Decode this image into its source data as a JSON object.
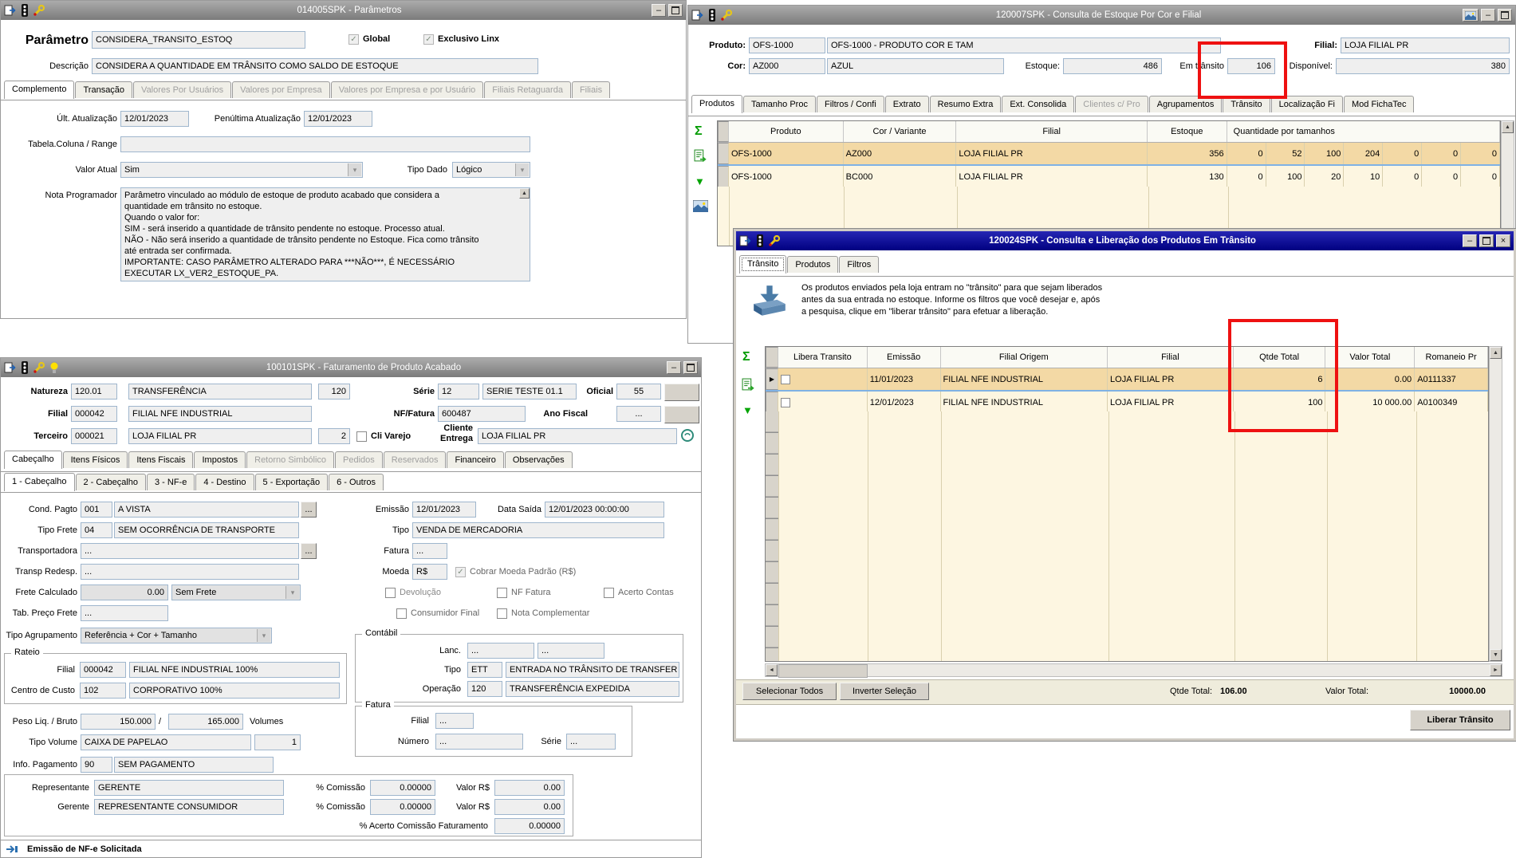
{
  "icons": {
    "sigma": "Σ",
    "filter_arrow": "▼",
    "row_marker": "▶",
    "arrow_up": "▲",
    "arrow_down": "▼",
    "arrow_left": "◄",
    "arrow_right": "►",
    "minimize": "–",
    "close": "×",
    "check": "✓",
    "combo": "▾",
    "dots": "..."
  },
  "win_parametros": {
    "title": "014005SPK - Parâmetros",
    "parametro_label": "Parâmetro",
    "parametro": "CONSIDERA_TRANSITO_ESTOQ",
    "global_label": "Global",
    "exclusivo_label": "Exclusivo Linx",
    "descricao_label": "Descrição",
    "descricao": "CONSIDERA A QUANTIDADE EM TRÂNSITO COMO SALDO DE ESTOQUE",
    "tabs": [
      "Complemento",
      "Transação",
      "Valores Por Usuários",
      "Valores por Empresa",
      "Valores por Empresa e por Usuário",
      "Filiais Retaguarda",
      "Filiais"
    ],
    "ult_label": "Últ. Atualização",
    "ult": "12/01/2023",
    "penultima_label": "Penúltima Atualização",
    "penultima": "12/01/2023",
    "tabela_label": "Tabela.Coluna / Range",
    "tabela_value": "",
    "valor_atual_label": "Valor Atual",
    "valor_atual": "Sim",
    "tipo_dado_label": "Tipo Dado",
    "tipo_dado": "Lógico",
    "nota_label": "Nota Programador",
    "nota": "Parâmetro vinculado ao módulo de estoque de produto acabado que considera a\nquantidade em trânsito no estoque.\nQuando o valor for:\nSIM - será inserido a quantidade de trânsito pendente no estoque. Processo atual.\nNÃO - Não será inserido a quantidade de trânsito pendente no Estoque. Fica como trânsito\naté entrada ser confirmada.\nIMPORTANTE: CASO PARÂMETRO ALTERADO PARA ***NÃO***, É NECESSÁRIO\nEXECUTAR LX_VER2_ESTOQUE_PA."
  },
  "win_estoque": {
    "title": "120007SPK - Consulta de Estoque Por Cor e Filial",
    "produto_label": "Produto:",
    "produto_cod": "OFS-1000",
    "produto_desc": "OFS-1000 - PRODUTO COR E TAM",
    "filial_label": "Filial:",
    "filial": "LOJA FILIAL PR",
    "cor_label": "Cor:",
    "cor_cod": "AZ000",
    "cor_desc": "AZUL",
    "estoque_label": "Estoque:",
    "estoque": "486",
    "em_transito_label": "Em trânsito",
    "em_transito": "106",
    "disponivel_label": "Disponível:",
    "disponivel": "380",
    "tabs": [
      "Produtos",
      "Tamanho Proc",
      "Filtros / Confi",
      "Extrato",
      "Resumo Extra",
      "Ext. Consolida",
      "Clientes c/ Pro",
      "Agrupamentos",
      "Trânsito",
      "Localização Fi",
      "Mod FichaTec"
    ],
    "grid": {
      "headers": [
        "Produto",
        "Cor / Variante",
        "Filial",
        "Estoque",
        "Quantidade por tamanhos"
      ],
      "rows": [
        {
          "produto": "OFS-1000",
          "cor": "AZ000",
          "filial": "LOJA FILIAL PR",
          "estoque": "356",
          "sizes": [
            "0",
            "52",
            "100",
            "204",
            "0",
            "0",
            "0"
          ]
        },
        {
          "produto": "OFS-1000",
          "cor": "BC000",
          "filial": "LOJA FILIAL PR",
          "estoque": "130",
          "sizes": [
            "0",
            "100",
            "20",
            "10",
            "0",
            "0",
            "0"
          ]
        }
      ]
    }
  },
  "win_transito": {
    "title": "120024SPK - Consulta e Liberação dos Produtos Em Trânsito",
    "tabs": [
      "Trânsito",
      "Produtos",
      "Filtros"
    ],
    "info": "Os produtos enviados pela loja entram no \"trânsito\" para que sejam liberados\nantes da sua entrada no estoque. Informe os filtros que você desejar e, após\na pesquisa, clique em \"liberar trânsito\" para efetuar a liberação.",
    "grid": {
      "headers": [
        "Libera Transito",
        "Emissão",
        "Filial Origem",
        "Filial",
        "Qtde Total",
        "Valor Total",
        "Romaneio Pr"
      ],
      "rows": [
        {
          "emissao": "11/01/2023",
          "origem": "FILIAL NFE INDUSTRIAL",
          "filial": "LOJA FILIAL PR",
          "qtde": "6",
          "valor": "0.00",
          "romaneio": "A0111337"
        },
        {
          "emissao": "12/01/2023",
          "origem": "FILIAL NFE INDUSTRIAL",
          "filial": "LOJA FILIAL PR",
          "qtde": "100",
          "valor": "10 000.00",
          "romaneio": "A0100349"
        }
      ]
    },
    "selecionar_todos": "Selecionar Todos",
    "inverter_selecao": "Inverter Seleção",
    "qtde_total_label": "Qtde Total:",
    "qtde_total": "106.00",
    "valor_total_label": "Valor Total:",
    "valor_total": "10000.00",
    "liberar_transito": "Liberar Trânsito"
  },
  "win_faturamento": {
    "title": "100101SPK - Faturamento de Produto Acabado",
    "header": {
      "natureza_label": "Natureza",
      "natureza_cod": "120.01",
      "natureza_desc": "TRANSFERÊNCIA",
      "natureza_num": "120",
      "serie_label": "Série",
      "serie_cod": "12",
      "serie_desc": "SERIE TESTE 01.1",
      "oficial_label": "Oficial",
      "oficial": "55",
      "filial_label": "Filial",
      "filial_cod": "000042",
      "filial_desc": "FILIAL NFE INDUSTRIAL",
      "nf_label": "NF/Fatura",
      "nf": "600487",
      "ano_fiscal_label": "Ano Fiscal",
      "ano_fiscal": "...",
      "terceiro_label": "Terceiro",
      "terceiro_cod": "000021",
      "terceiro_desc": "LOJA FILIAL PR",
      "terceiro_num": "2",
      "cli_varejo_label": "Cli Varejo",
      "cliente_entrega_label": "Cliente Entrega",
      "cliente_entrega": "LOJA FILIAL PR"
    },
    "tabs": [
      "Cabeçalho",
      "Itens Físicos",
      "Itens Fiscais",
      "Impostos",
      "Retorno Simbólico",
      "Pedidos",
      "Reservados",
      "Financeiro",
      "Observações"
    ],
    "subtabs": [
      "1 - Cabeçalho",
      "2 - Cabeçalho",
      "3 - NF-e",
      "4 - Destino",
      "5 - Exportação",
      "6 - Outros"
    ],
    "fields": {
      "cond_pagto_label": "Cond. Pagto",
      "cond_pagto_cod": "001",
      "cond_pagto_desc": "A VISTA",
      "emissao_label": "Emissão",
      "emissao": "12/01/2023",
      "data_saida_label": "Data Saída",
      "data_saida": "12/01/2023 00:00:00",
      "tipo_frete_label": "Tipo Frete",
      "tipo_frete_cod": "04",
      "tipo_frete_desc": "SEM OCORRÊNCIA DE TRANSPORTE",
      "tipo_label": "Tipo",
      "tipo": "VENDA DE MERCADORIA",
      "transportadora_label": "Transportadora",
      "transportadora": "...",
      "fatura_label": "Fatura",
      "fatura": "...",
      "transp_redesp_label": "Transp Redesp.",
      "transp_redesp": "...",
      "moeda_label": "Moeda",
      "moeda": "R$",
      "cobrar_moeda_label": "Cobrar Moeda Padrão (R$)",
      "frete_calculado_label": "Frete Calculado",
      "frete_calculado": "0.00",
      "sem_frete": "Sem Frete",
      "devolucao_label": "Devolução",
      "nf_fatura_label": "NF Fatura",
      "acerto_contas_label": "Acerto Contas",
      "tab_preco_frete_label": "Tab. Preço Frete",
      "tab_preco_frete": "...",
      "consumidor_final_label": "Consumidor Final",
      "nota_complementar_label": "Nota Complementar",
      "tipo_agrupamento_label": "Tipo Agrupamento",
      "tipo_agrupamento": "Referência + Cor + Tamanho",
      "contabil_label": "Contábil",
      "lanc_label": "Lanc.",
      "lanc1": "...",
      "lanc2": "...",
      "ctipo_label": "Tipo",
      "ctipo_cod": "ETT",
      "ctipo_desc": "ENTRADA NO TRÂNSITO DE TRANSFER",
      "operacao_label": "Operação",
      "operacao_cod": "120",
      "operacao_desc": "TRANSFERÊNCIA EXPEDIDA",
      "rateio_label": "Rateio",
      "rfilial_label": "Filial",
      "rfilial_cod": "000042",
      "rfilial_desc": "FILIAL NFE INDUSTRIAL 100%",
      "centro_custo_label": "Centro de Custo",
      "centro_custo_cod": "102",
      "centro_custo_desc": "CORPORATIVO 100%",
      "peso_label": "Peso Liq. / Bruto",
      "peso_liq": "150.000",
      "peso_sep": "/",
      "peso_bruto": "165.000",
      "volumes_label": "Volumes",
      "tipo_volume_label": "Tipo Volume",
      "tipo_volume": "CAIXA DE PAPELAO",
      "volumes": "1",
      "ffatura_label": "Fatura",
      "ffilial_label": "Filial",
      "ffilial": "...",
      "numero_label": "Número",
      "numero": "...",
      "fserie_label": "Série",
      "fserie": "...",
      "info_pagamento_label": "Info. Pagamento",
      "info_pagamento_cod": "90",
      "info_pagamento_desc": "SEM PAGAMENTO",
      "representante_label": "Representante",
      "representante": "GERENTE",
      "comissao1_label": "% Comissão",
      "comissao1": "0.00000",
      "valor1_label": "Valor R$",
      "valor1": "0.00",
      "gerente_label": "Gerente",
      "gerente": "REPRESENTANTE CONSUMIDOR",
      "comissao2_label": "% Comissão",
      "comissao2": "0.00000",
      "valor2_label": "Valor R$",
      "valor2": "0.00",
      "acerto_label": "% Acerto Comissão Faturamento",
      "acerto": "0.00000"
    },
    "status": "Emissão de NF-e Solicitada"
  }
}
